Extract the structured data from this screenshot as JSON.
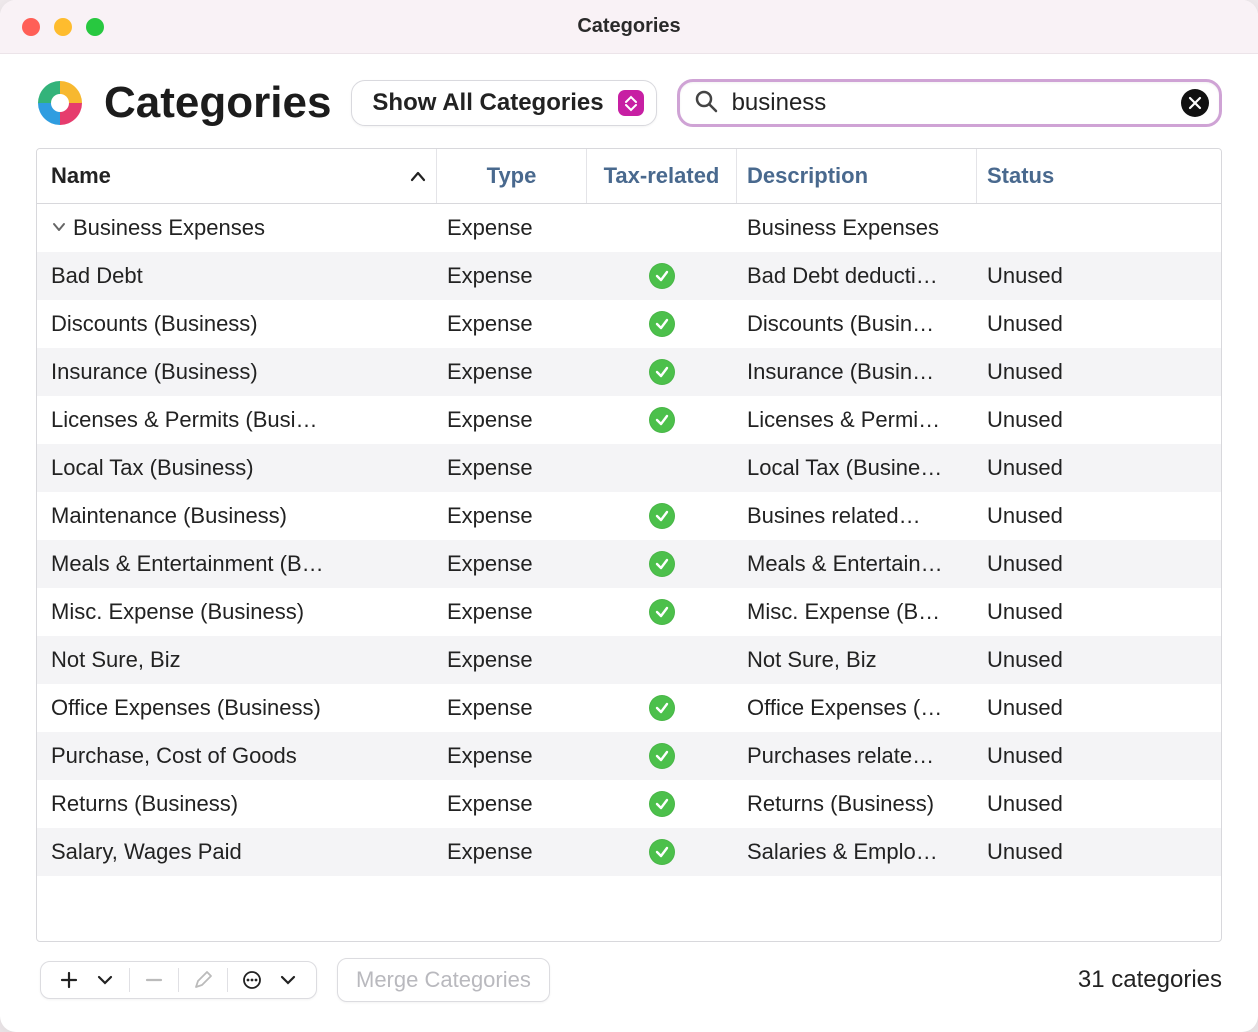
{
  "window": {
    "title": "Categories"
  },
  "header": {
    "page_title": "Categories",
    "filter_label": "Show All Categories",
    "search_value": "business"
  },
  "columns": {
    "name": "Name",
    "type": "Type",
    "tax": "Tax-related",
    "desc": "Description",
    "status": "Status"
  },
  "rows": [
    {
      "indent": 0,
      "expandable": true,
      "name": "Business Expenses",
      "type": "Expense",
      "tax": false,
      "desc": "Business Expenses",
      "status": ""
    },
    {
      "indent": 1,
      "expandable": false,
      "name": "Bad Debt",
      "type": "Expense",
      "tax": true,
      "desc": "Bad Debt deducti…",
      "status": "Unused"
    },
    {
      "indent": 1,
      "expandable": false,
      "name": "Discounts (Business)",
      "type": "Expense",
      "tax": true,
      "desc": "Discounts (Busin…",
      "status": "Unused"
    },
    {
      "indent": 1,
      "expandable": false,
      "name": "Insurance (Business)",
      "type": "Expense",
      "tax": true,
      "desc": "Insurance (Busin…",
      "status": "Unused"
    },
    {
      "indent": 1,
      "expandable": false,
      "name": "Licenses & Permits (Busi…",
      "type": "Expense",
      "tax": true,
      "desc": "Licenses & Permi…",
      "status": "Unused"
    },
    {
      "indent": 1,
      "expandable": false,
      "name": "Local Tax (Business)",
      "type": "Expense",
      "tax": false,
      "desc": "Local Tax (Busine…",
      "status": "Unused"
    },
    {
      "indent": 1,
      "expandable": false,
      "name": "Maintenance (Business)",
      "type": "Expense",
      "tax": true,
      "desc": "Busines related…",
      "status": "Unused"
    },
    {
      "indent": 1,
      "expandable": false,
      "name": "Meals & Entertainment (B…",
      "type": "Expense",
      "tax": true,
      "desc": "Meals & Entertain…",
      "status": "Unused"
    },
    {
      "indent": 1,
      "expandable": false,
      "name": "Misc. Expense (Business)",
      "type": "Expense",
      "tax": true,
      "desc": "Misc. Expense (B…",
      "status": "Unused"
    },
    {
      "indent": 1,
      "expandable": false,
      "name": "Not Sure, Biz",
      "type": "Expense",
      "tax": false,
      "desc": "Not Sure, Biz",
      "status": "Unused"
    },
    {
      "indent": 1,
      "expandable": false,
      "name": "Office Expenses (Business)",
      "type": "Expense",
      "tax": true,
      "desc": "Office Expenses (…",
      "status": "Unused"
    },
    {
      "indent": 1,
      "expandable": false,
      "name": "Purchase, Cost of Goods",
      "type": "Expense",
      "tax": true,
      "desc": "Purchases relate…",
      "status": "Unused"
    },
    {
      "indent": 1,
      "expandable": false,
      "name": "Returns (Business)",
      "type": "Expense",
      "tax": true,
      "desc": "Returns (Business)",
      "status": "Unused"
    },
    {
      "indent": 1,
      "expandable": false,
      "name": "Salary, Wages Paid",
      "type": "Expense",
      "tax": true,
      "desc": "Salaries & Emplo…",
      "status": "Unused"
    }
  ],
  "footer": {
    "merge_label": "Merge Categories",
    "count_label": "31 categories"
  }
}
